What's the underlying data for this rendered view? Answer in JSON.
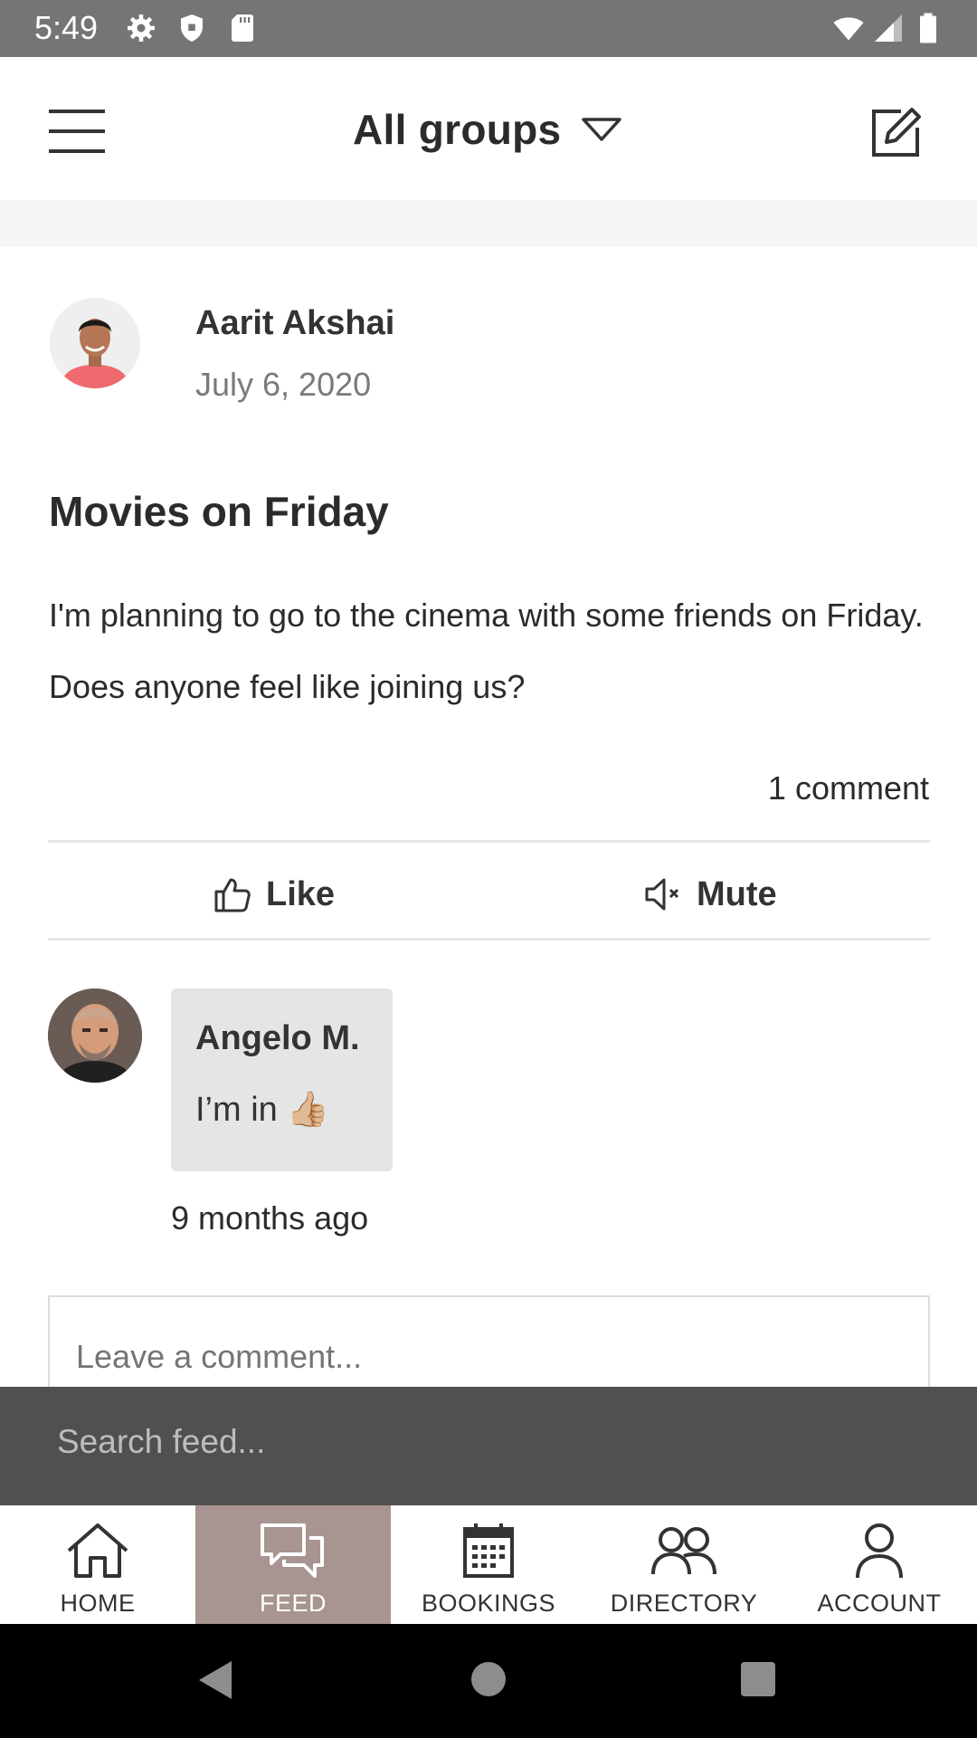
{
  "status_bar": {
    "time": "5:49"
  },
  "app_bar": {
    "title": "All groups"
  },
  "post": {
    "author": "Aarit Akshai",
    "date": "July 6, 2020",
    "title": "Movies on Friday",
    "body": "I'm planning to go to the cinema with some friends on Friday. Does anyone feel like joining us?",
    "comment_count": "1 comment",
    "actions": {
      "like": "Like",
      "mute": "Mute"
    }
  },
  "comment": {
    "author": "Angelo M.",
    "text": "I’m in",
    "emoji": "👍🏼",
    "time": "9 months ago"
  },
  "comment_input": {
    "placeholder": "Leave a comment..."
  },
  "search": {
    "placeholder": "Search feed..."
  },
  "bottom_nav": {
    "items": [
      {
        "label": "HOME",
        "icon": "home-icon",
        "active": false
      },
      {
        "label": "FEED",
        "icon": "chat-bubbles-icon",
        "active": true
      },
      {
        "label": "BOOKINGS",
        "icon": "calendar-icon",
        "active": false
      },
      {
        "label": "DIRECTORY",
        "icon": "people-icon",
        "active": false
      },
      {
        "label": "ACCOUNT",
        "icon": "person-icon",
        "active": false
      }
    ]
  },
  "colors": {
    "status_bar": "#757575",
    "search_band": "#505050",
    "active_nav": "#a89490",
    "comment_bubble": "#e5e5e5"
  }
}
